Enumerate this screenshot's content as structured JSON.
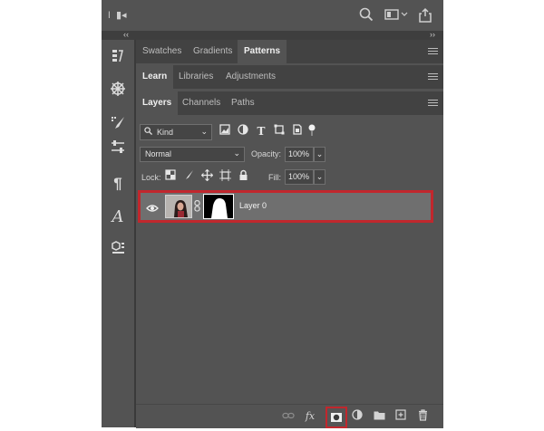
{
  "top_icons": [
    "toggle-icon",
    "film-icon",
    "search-icon",
    "window-icon",
    "share-icon"
  ],
  "collapse": {
    "left": "‹‹",
    "right": "››"
  },
  "panel_groups": [
    {
      "tabs": [
        "Swatches",
        "Gradients",
        "Patterns"
      ],
      "active": "Patterns"
    },
    {
      "tabs": [
        "Learn",
        "Libraries",
        "Adjustments"
      ],
      "active": "Learn"
    },
    {
      "tabs": [
        "Layers",
        "Channels",
        "Paths"
      ],
      "active": "Layers"
    }
  ],
  "layers": {
    "filter_kind": "Kind",
    "blend_mode": "Normal",
    "opacity_label": "Opacity:",
    "opacity_value": "100%",
    "lock_label": "Lock:",
    "fill_label": "Fill:",
    "fill_value": "100%",
    "items": [
      {
        "name": "Layer 0",
        "visible": true,
        "has_mask": true
      }
    ]
  },
  "colors": {
    "highlight": "#c1272d",
    "panel": "#535353",
    "tabbar": "#424242"
  }
}
